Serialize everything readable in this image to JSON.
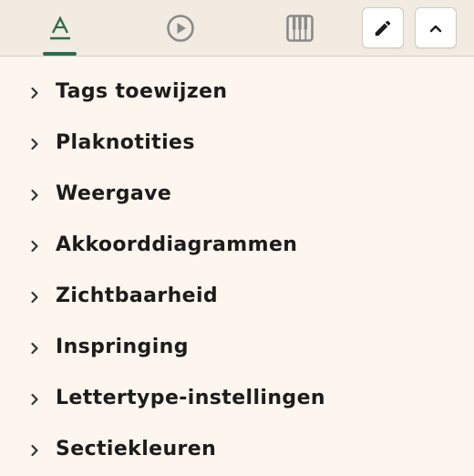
{
  "colors": {
    "background": "#fdf6ee",
    "toolbar": "#f1ebe1",
    "accent": "#2f6b4e",
    "icon_inactive": "#8a8a8a",
    "text": "#1c1c1c"
  },
  "toolbar": {
    "tabs": [
      {
        "icon": "text-format-icon",
        "active": true
      },
      {
        "icon": "play-circle-icon",
        "active": false
      },
      {
        "icon": "piano-keys-icon",
        "active": false
      }
    ],
    "buttons": [
      {
        "icon": "pencil-icon"
      },
      {
        "icon": "chevron-up-icon"
      }
    ]
  },
  "sections": [
    {
      "label": "Tags toewijzen"
    },
    {
      "label": "Plaknotities"
    },
    {
      "label": "Weergave"
    },
    {
      "label": "Akkoorddiagrammen"
    },
    {
      "label": "Zichtbaarheid"
    },
    {
      "label": "Inspringing"
    },
    {
      "label": "Lettertype-instellingen"
    },
    {
      "label": "Sectiekleuren"
    }
  ]
}
